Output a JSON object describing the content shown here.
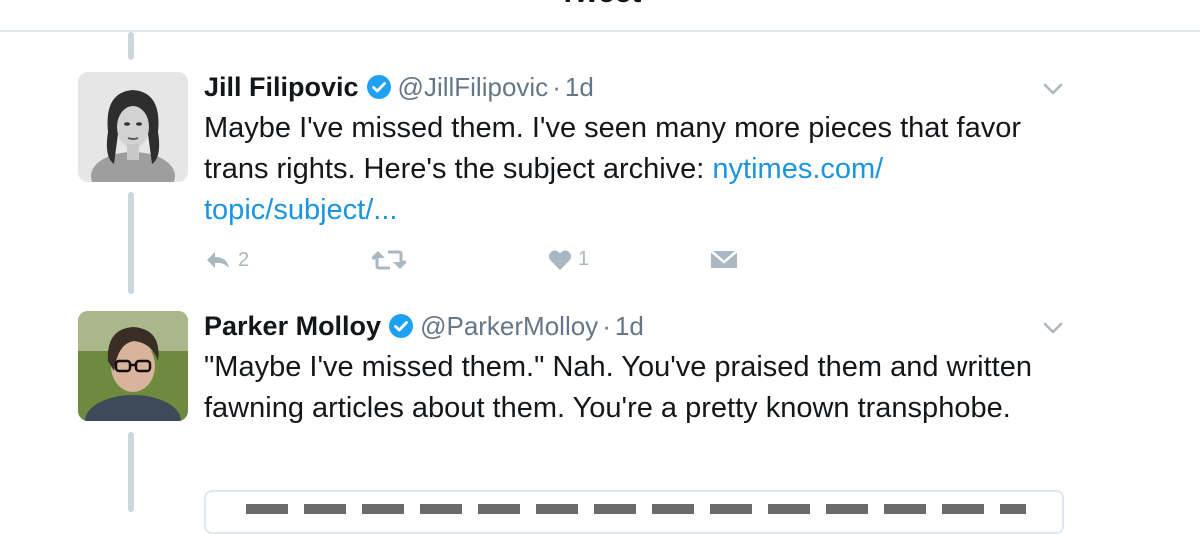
{
  "header": {
    "title": "Tweet"
  },
  "colors": {
    "link": "#1b95e0",
    "verified": "#1da1f2",
    "muted": "#657786",
    "icon": "#aab8c2",
    "thread_line": "#ccd6dd"
  },
  "tweets": [
    {
      "name": "Jill Filipovic",
      "verified": true,
      "handle": "@JillFilipovic",
      "separator": "·",
      "time": "1d",
      "text": "Maybe I've missed them. I've seen many more pieces that favor trans rights. Here's the subject archive: ",
      "link": "nytimes.com/ topic/subject/...",
      "actions": {
        "reply_count": "2",
        "retweet_count": "",
        "like_count": "1"
      },
      "icons": [
        "reply-icon",
        "retweet-icon",
        "heart-icon",
        "dm-icon",
        "chevron-down-icon"
      ]
    },
    {
      "name": "Parker Molloy",
      "verified": true,
      "handle": "@ParkerMolloy",
      "separator": "·",
      "time": "1d",
      "text": "\"Maybe I've missed them.\" Nah. You've praised them and written fawning articles about them. You're a pretty known transphobe.",
      "icons": [
        "chevron-down-icon"
      ]
    }
  ]
}
